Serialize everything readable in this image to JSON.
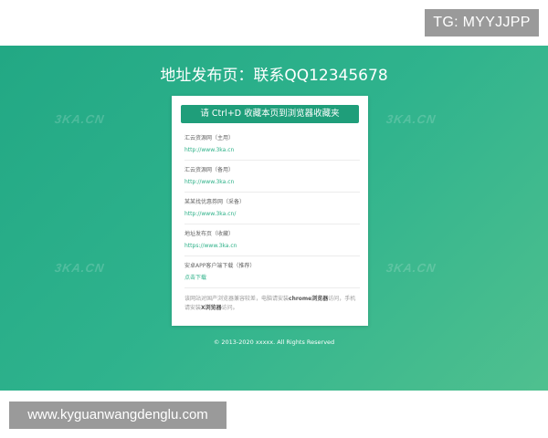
{
  "badge": {
    "text": "TG: MYYJJPP"
  },
  "header": {
    "title": "地址发布页：联系QQ12345678"
  },
  "watermark": {
    "text": "3KA.CN"
  },
  "card": {
    "bookmark_label": "请 Ctrl+D 收藏本页到浏览器收藏夹",
    "links": [
      {
        "name": "汇云资源网（主用）",
        "url": "http://www.3ka.cn"
      },
      {
        "name": "汇云资源网（备用）",
        "url": "http://www.3ka.cn"
      },
      {
        "name": "某某找优惠券网（采备）",
        "url": "http://www.3ka.cn/"
      },
      {
        "name": "地址发布页（收藏）",
        "url": "https://www.3ka.cn"
      }
    ],
    "download": {
      "title": "安卓APP客户端下载（推荐）",
      "link_label": "点击下载"
    },
    "tip": {
      "part1": "该网站对国产浏览器兼容较差，电脑请安装",
      "bold1": "chrome浏览器",
      "part2": "访问，手机请安装",
      "bold2": "X浏览器",
      "part3": "访问。"
    }
  },
  "footer": {
    "copyright": "© 2013-2020 xxxxx. All Rights Reserved"
  },
  "url_bar": {
    "text": "www.kyguanwangdenglu.com"
  },
  "colors": {
    "hero_gradient_start": "#22a884",
    "hero_gradient_end": "#4fc08f",
    "button": "#1f9e7a",
    "link": "#2bb087",
    "overlay_gray": "#9a9a9a"
  }
}
